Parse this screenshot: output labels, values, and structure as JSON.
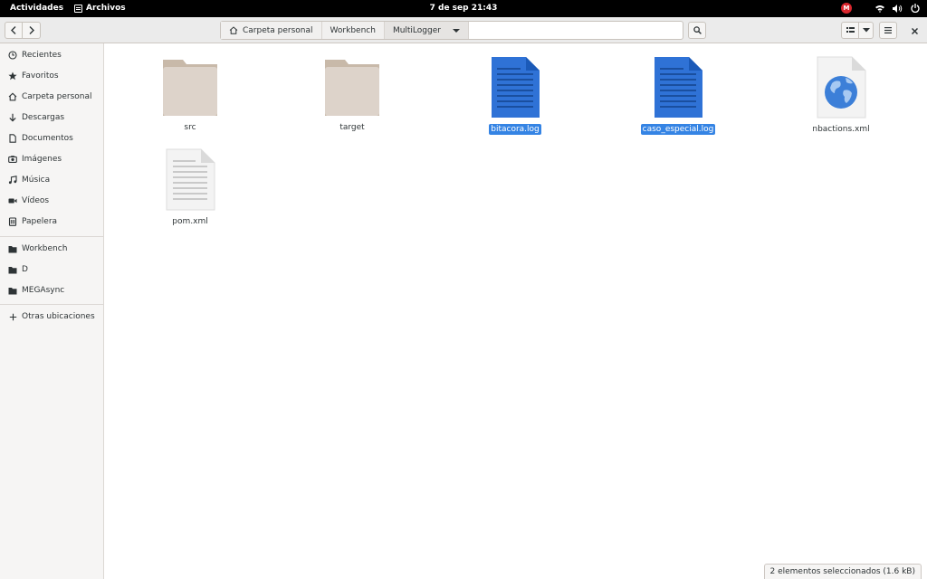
{
  "topbar": {
    "activities": "Actividades",
    "app_name": "Archivos",
    "clock": "7 de sep  21:43",
    "mega_icon_letter": "M"
  },
  "pathbar": {
    "crumbs": [
      "Carpeta personal",
      "Workbench",
      "MultiLogger"
    ]
  },
  "sidebar": {
    "items": [
      {
        "label": "Recientes",
        "icon": "clock-icon"
      },
      {
        "label": "Favoritos",
        "icon": "star-icon"
      },
      {
        "label": "Carpeta personal",
        "icon": "home-icon"
      },
      {
        "label": "Descargas",
        "icon": "download-icon"
      },
      {
        "label": "Documentos",
        "icon": "document-icon"
      },
      {
        "label": "Imágenes",
        "icon": "camera-icon"
      },
      {
        "label": "Música",
        "icon": "music-icon"
      },
      {
        "label": "Vídeos",
        "icon": "video-icon"
      },
      {
        "label": "Papelera",
        "icon": "trash-icon"
      }
    ],
    "bookmarks": [
      {
        "label": "Workbench",
        "icon": "folder-icon"
      },
      {
        "label": "D",
        "icon": "folder-icon"
      },
      {
        "label": "MEGAsync",
        "icon": "folder-icon"
      }
    ],
    "other_locations": "Otras ubicaciones"
  },
  "files": [
    {
      "name": "src",
      "type": "folder",
      "selected": false
    },
    {
      "name": "target",
      "type": "folder",
      "selected": false
    },
    {
      "name": "bitacora.log",
      "type": "log",
      "selected": true
    },
    {
      "name": "caso_especial.log",
      "type": "log",
      "selected": true
    },
    {
      "name": "nbactions.xml",
      "type": "xml-web",
      "selected": false
    },
    {
      "name": "pom.xml",
      "type": "text",
      "selected": false
    }
  ],
  "status": "2 elementos seleccionados  (1.6 kB)",
  "colors": {
    "accent": "#3584e4",
    "folder": "#d9d0c7",
    "sidebar_bg": "#f6f5f4"
  }
}
